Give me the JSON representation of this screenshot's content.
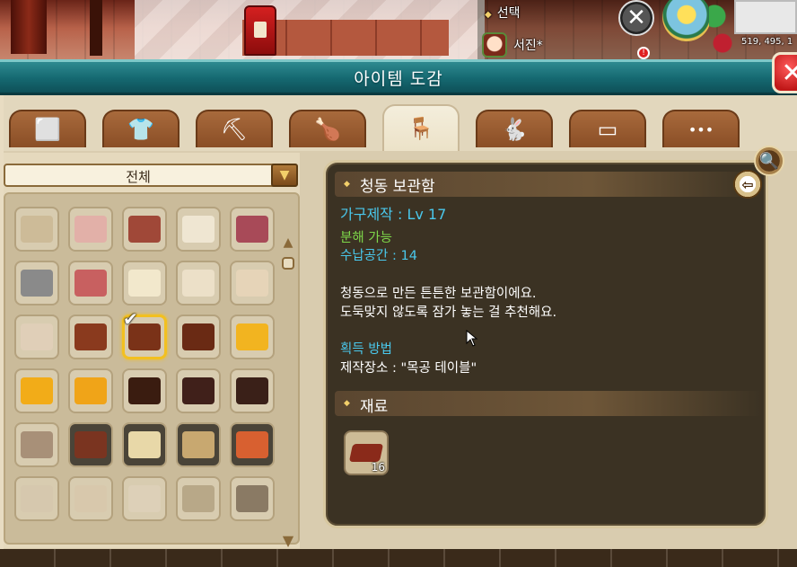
{
  "hud": {
    "select_label": "선택",
    "player_name": "서진*",
    "coords": "519, 495, 1",
    "close_glyph": "✕",
    "notification_count": "!"
  },
  "window": {
    "title": "아이템 도감",
    "close_glyph": "✕"
  },
  "tabs": [
    {
      "name": "block",
      "icon": "cube-icon",
      "glyph": "⬜",
      "active": false
    },
    {
      "name": "clothing",
      "icon": "shirt-icon",
      "glyph": "👕",
      "active": false
    },
    {
      "name": "tools",
      "icon": "pickaxe-icon",
      "glyph": "⛏",
      "active": false
    },
    {
      "name": "food",
      "icon": "roast-chicken-icon",
      "glyph": "🍗",
      "active": false
    },
    {
      "name": "furniture",
      "icon": "chair-icon",
      "glyph": "🪑",
      "active": true
    },
    {
      "name": "pets",
      "icon": "rabbit-icon",
      "glyph": "🐇",
      "active": false
    },
    {
      "name": "misc-items",
      "icon": "case-icon",
      "glyph": "▭",
      "active": false
    },
    {
      "name": "more",
      "icon": "more-icon",
      "glyph": "•••",
      "active": false
    }
  ],
  "search": {
    "icon": "magnifier-icon",
    "glyph": "🔍"
  },
  "filter": {
    "label": "전체",
    "arrow": "▼"
  },
  "grid": {
    "rows": [
      [
        {
          "name": "round-chair",
          "color": "#cdbb98"
        },
        {
          "name": "pink-bed",
          "color": "#e2b0a8"
        },
        {
          "name": "wall-banner",
          "color": "#a04838"
        },
        {
          "name": "white-desk",
          "color": "#efe6d2"
        },
        {
          "name": "pink-lamp",
          "color": "#a84a58"
        }
      ],
      [
        {
          "name": "stone-oven",
          "color": "#8a8a8a"
        },
        {
          "name": "kitchen-pot",
          "color": "#c86060"
        },
        {
          "name": "wooden-sign",
          "color": "#f2e8cc"
        },
        {
          "name": "paper-board",
          "color": "#ece0c8"
        },
        {
          "name": "wooden-door",
          "color": "#e6d4b8"
        }
      ],
      [
        {
          "name": "white-door",
          "color": "#e0cfb8"
        },
        {
          "name": "brown-chest",
          "color": "#8a3a1e"
        },
        {
          "name": "bronze-chest",
          "color": "#7a3218",
          "selected": true
        },
        {
          "name": "wood-chest",
          "color": "#6a2a14"
        },
        {
          "name": "gold-chest",
          "color": "#f2b420"
        }
      ],
      [
        {
          "name": "gold-chest-2",
          "color": "#f2ac18"
        },
        {
          "name": "gold-chest-3",
          "color": "#f0a418"
        },
        {
          "name": "dark-chest",
          "color": "#3a1c10"
        },
        {
          "name": "dark-chest-2",
          "color": "#40201a"
        },
        {
          "name": "dark-chest-3",
          "color": "#3a2018"
        }
      ],
      [
        {
          "name": "firewood",
          "color": "#a89078"
        },
        {
          "name": "steak-plate",
          "color": "#7a3420",
          "dark": true
        },
        {
          "name": "soup-bowl",
          "color": "#e8d8a8",
          "dark": true
        },
        {
          "name": "water-bucket",
          "color": "#c8a870",
          "dark": true
        },
        {
          "name": "pizza-plate",
          "color": "#d86030",
          "dark": true
        }
      ],
      [
        {
          "name": "bookshelf",
          "color": "#d6c8ae"
        },
        {
          "name": "vanity-desk",
          "color": "#d8c8ac"
        },
        {
          "name": "vanity-chair",
          "color": "#ddd0b8"
        },
        {
          "name": "grandfather-clock",
          "color": "#b8a888"
        },
        {
          "name": "storage-box",
          "color": "#8a7a64"
        }
      ]
    ],
    "scroll_up": "▲",
    "scroll_down": "▼"
  },
  "detail": {
    "title": "청동 보관함",
    "craft_req": "가구제작 : Lv 17",
    "dismantle": "분해 가능",
    "storage": "수납공간 : 14",
    "desc_line1": "청동으로 만든 튼튼한 보관함이에요.",
    "desc_line2": "도둑맞지 않도록 잠가 놓는 걸 추천해요.",
    "obtain_header": "획득 방법",
    "obtain_place": "제작장소 : \"목공 테이블\"",
    "materials_title": "재료",
    "back_glyph": "⇦",
    "materials": [
      {
        "name": "bronze-ingot",
        "color": "#8a2a1a",
        "count": "16"
      }
    ]
  },
  "colors": {
    "title_teal": "#156870",
    "panel_beige": "#d9ccaf",
    "detail_bg": "#3b3223",
    "accent_cyan": "#4ac8ec",
    "accent_green": "#7ed84a",
    "selected_gold": "#f2c020"
  }
}
